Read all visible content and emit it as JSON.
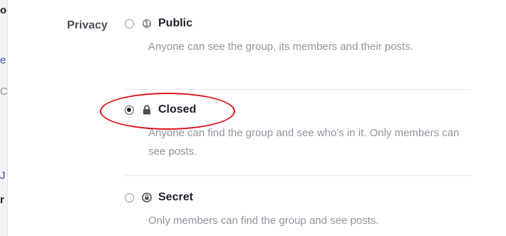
{
  "privacy": {
    "label": "Privacy",
    "options": [
      {
        "title": "Public",
        "icon": "globe-icon",
        "selected": false,
        "description": "Anyone can see the group, its members and their posts."
      },
      {
        "title": "Closed",
        "icon": "lock-icon",
        "selected": true,
        "description": "Anyone can find the group and see who's in it. Only members can see posts."
      },
      {
        "title": "Secret",
        "icon": "secret-icon",
        "selected": false,
        "description": "Only members can find the group and see posts."
      }
    ]
  },
  "left_edge_fragments": [
    "o",
    "e",
    "C",
    "J",
    "r"
  ],
  "colors": {
    "highlight": "#d9161c",
    "title_text": "#1d2129",
    "desc_text": "#90949c",
    "label_text": "#4b4f56"
  }
}
